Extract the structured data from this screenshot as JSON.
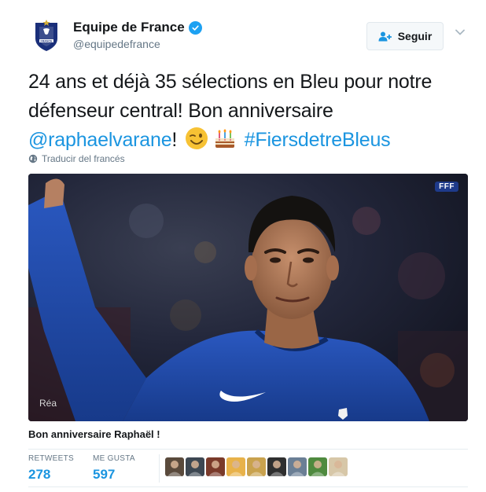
{
  "account": {
    "name": "Equipe de France",
    "handle": "@equipedefrance",
    "verified": true,
    "avatar_icon": "fff-crest-icon",
    "avatar_label": "FRANCE"
  },
  "follow_button": {
    "label": "Seguir",
    "icon": "add-user-icon"
  },
  "tweet": {
    "text_before": "24 ans et déjà 35 sélections en Bleu pour notre défenseur central! Bon anniversaire ",
    "mention": "@raphaelvarane",
    "text_after_mention": "! ",
    "emojis": [
      "winking-face-emoji",
      "birthday-cake-emoji"
    ],
    "hashtag": "#FiersdetreBleus"
  },
  "translate": {
    "label": "Traducir del francés",
    "icon": "globe-icon"
  },
  "media": {
    "credit": "Réa",
    "badge": "FFF",
    "description_icon": "video-still"
  },
  "caption": "Bon anniversaire Raphaël !",
  "stats": {
    "retweets_label": "RETWEETS",
    "retweets_value": "278",
    "likes_label": "ME GUSTA",
    "likes_value": "597"
  },
  "colors": {
    "link": "#1b95e0",
    "verified": "#1da1f2",
    "text": "#14171a",
    "secondary": "#657786",
    "jersey": "#1f4aa8"
  },
  "likers": [
    {
      "name": "liker-avatar-1",
      "color": "#5a4a3c"
    },
    {
      "name": "liker-avatar-2",
      "color": "#3d4752"
    },
    {
      "name": "liker-avatar-3",
      "color": "#7a3a2a"
    },
    {
      "name": "liker-avatar-4",
      "color": "#e8b24a"
    },
    {
      "name": "liker-avatar-5",
      "color": "#c9a24e"
    },
    {
      "name": "liker-avatar-6",
      "color": "#2f2f2f"
    },
    {
      "name": "liker-avatar-7",
      "color": "#6b7f95"
    },
    {
      "name": "liker-avatar-8",
      "color": "#4f8a3f"
    },
    {
      "name": "liker-avatar-9",
      "color": "#d7c7a8"
    }
  ]
}
